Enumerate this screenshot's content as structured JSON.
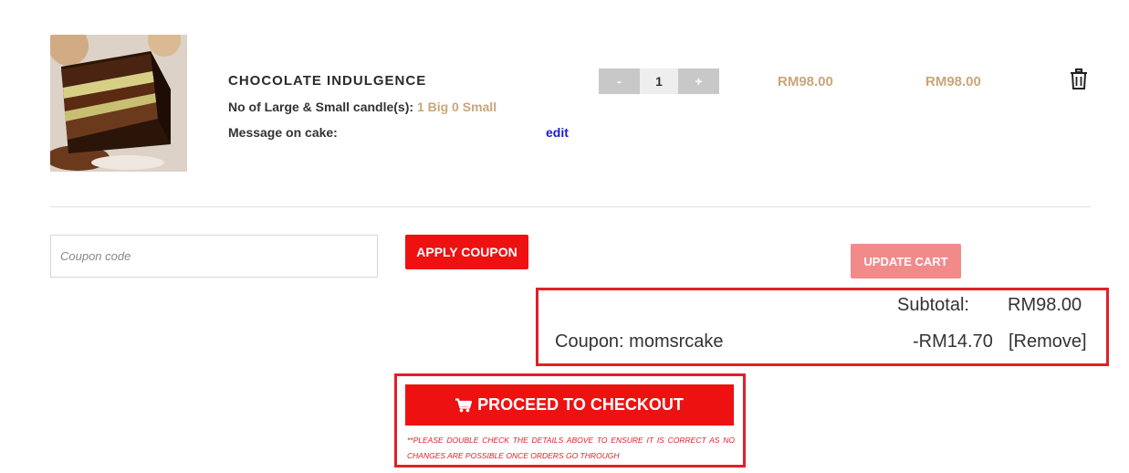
{
  "cart_item": {
    "name": "CHOCOLATE INDULGENCE",
    "candles_label": "No of Large & Small candle(s):",
    "candles_value": "1 Big 0 Small",
    "message_label": "Message on cake:",
    "edit_label": "edit",
    "qty_minus": "-",
    "qty_value": "1",
    "qty_plus": "+",
    "unit_price": "RM98.00",
    "line_total": "RM98.00",
    "image_icon": "chocolate-cake-slice",
    "remove_icon": "trash-icon"
  },
  "coupon": {
    "placeholder": "Coupon code",
    "apply_label": "APPLY COUPON",
    "update_label": "UPDATE CART"
  },
  "totals": {
    "subtotal_label": "Subtotal:",
    "subtotal_value": "RM98.00",
    "coupon_label": "Coupon: momsrcake",
    "coupon_value": "-RM14.70",
    "remove_label": "[Remove]"
  },
  "checkout": {
    "button_label": "PROCEED TO CHECKOUT",
    "button_icon": "cart-icon",
    "note": "**Please double check the details above to ensure it is correct as no changes are possible once orders go through"
  },
  "colors": {
    "accent_red": "#ee1111",
    "highlight_border": "#e0202a",
    "price_gold": "#c9a679",
    "link_blue": "#1a1ad6"
  }
}
